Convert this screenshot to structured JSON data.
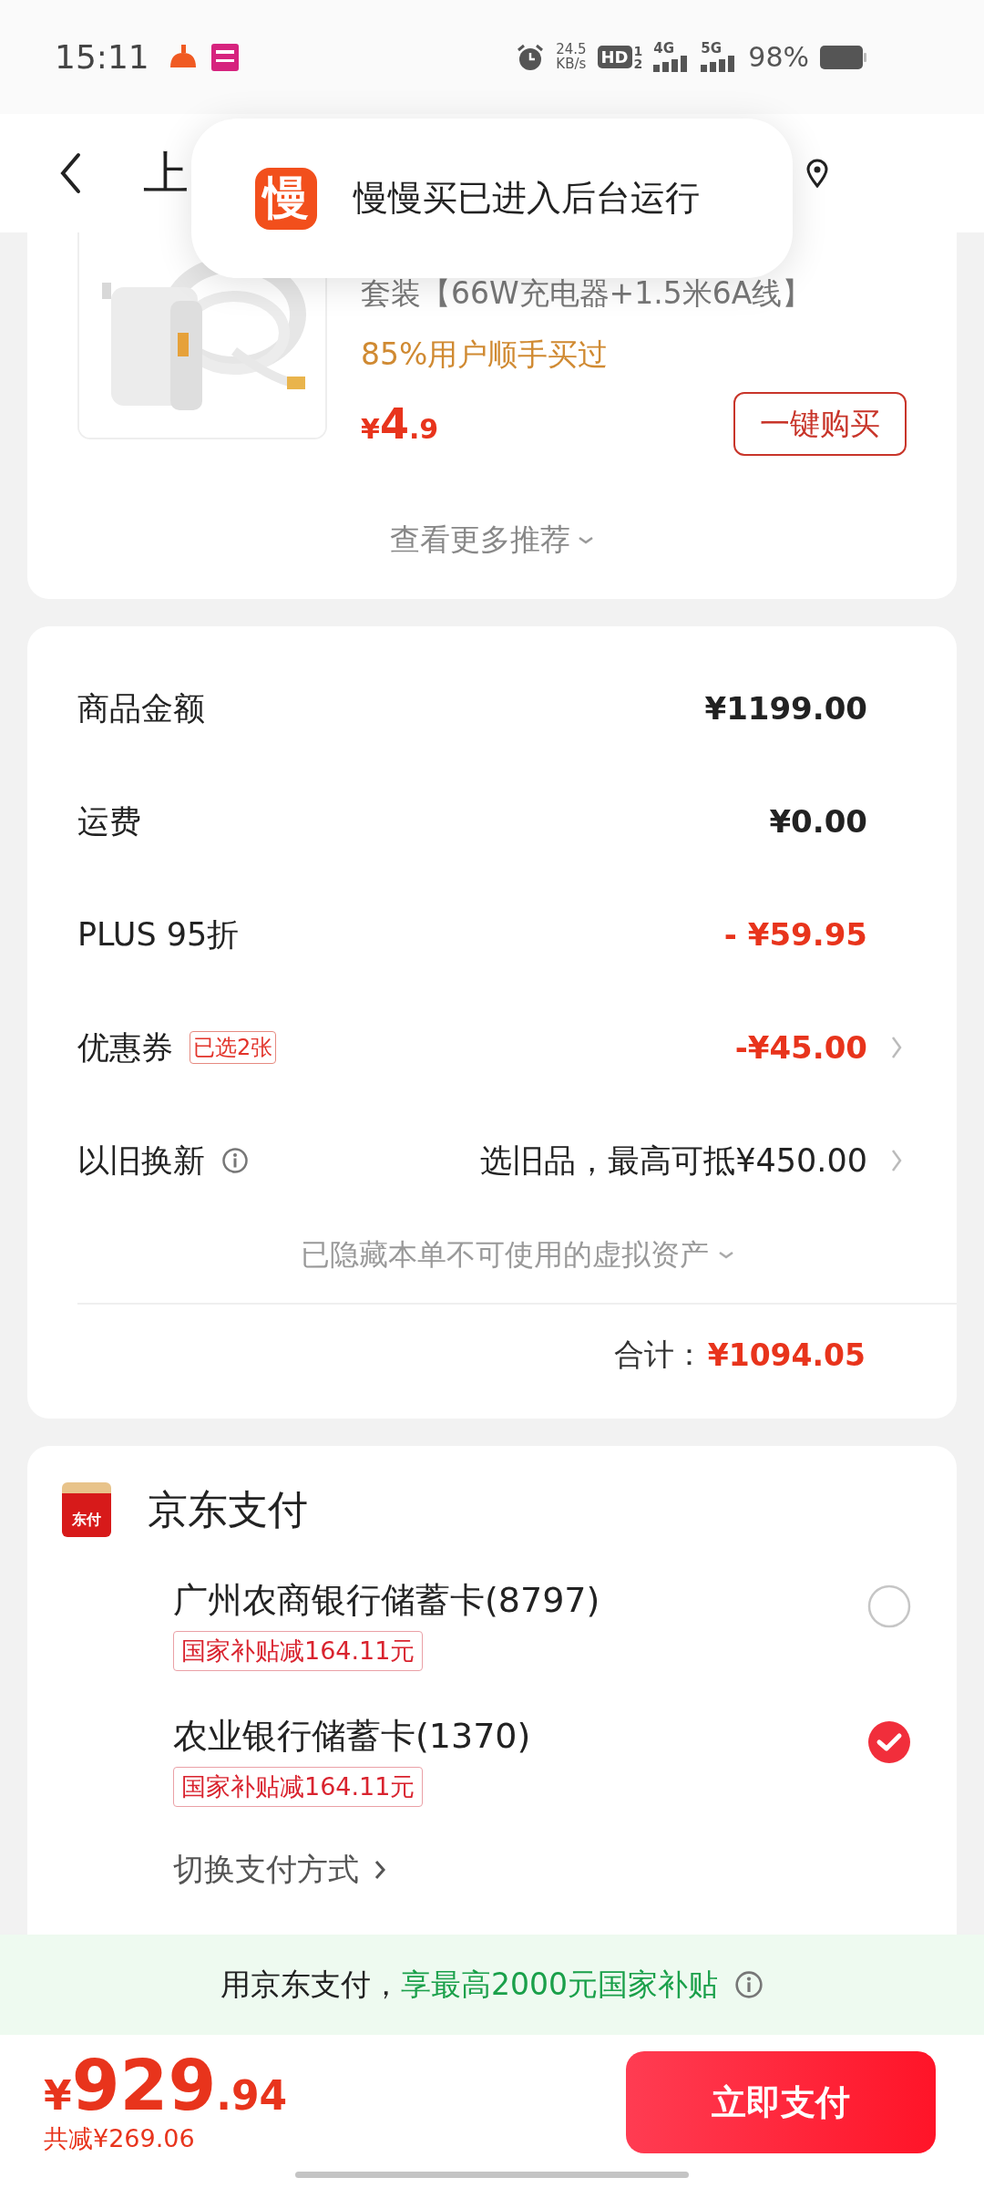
{
  "status_bar": {
    "time": "15:11",
    "net_speed": "24.5",
    "net_unit": "KB/s",
    "hd": "HD",
    "sim_1": "1",
    "sim_2": "2",
    "network_1": "4G",
    "network_2": "5G",
    "battery": "98%"
  },
  "header": {
    "title": "上"
  },
  "toast": {
    "app_icon": "慢",
    "message": "慢慢买已进入后台运行"
  },
  "recommendation": {
    "title": "套装【66W充电器+1.5米6A线】",
    "note": "85%用户顺手买过",
    "price_symbol": "¥",
    "price_int": "4",
    "price_dec": ".9",
    "buy_button": "一键购买",
    "more": "查看更多推荐"
  },
  "summary": {
    "rows": [
      {
        "kind": "amount",
        "label": "商品金额",
        "value": "¥1199.00"
      },
      {
        "kind": "amount",
        "label": "运费",
        "value": "¥0.00"
      },
      {
        "kind": "discount",
        "label": "PLUS 95折",
        "value": "- ¥59.95"
      },
      {
        "kind": "coupon",
        "label": "优惠券",
        "badge": "已选2张",
        "value": "-¥45.00"
      },
      {
        "kind": "trade_in",
        "label": "以旧换新",
        "value": "选旧品，最高可抵¥450.00"
      }
    ],
    "hidden_note": "已隐藏本单不可使用的虚拟资产",
    "total_label": "合计：",
    "total": "¥1094.05"
  },
  "payment": {
    "brand_icon": "东付",
    "title": "京东支付",
    "methods": [
      {
        "name": "广州农商银行储蓄卡(8797)",
        "tag": "国家补贴减164.11元",
        "selected": false
      },
      {
        "name": "农业银行储蓄卡(1370)",
        "tag": "国家补贴减164.11元",
        "selected": true
      }
    ],
    "switch": "切换支付方式"
  },
  "banner": {
    "text": "用京东支付，",
    "highlight": "享最高2000元国家补贴"
  },
  "footer": {
    "currency": "¥",
    "amount_int": "929",
    "amount_dec": ".94",
    "saved": "共减¥269.06",
    "pay_button": "立即支付"
  }
}
